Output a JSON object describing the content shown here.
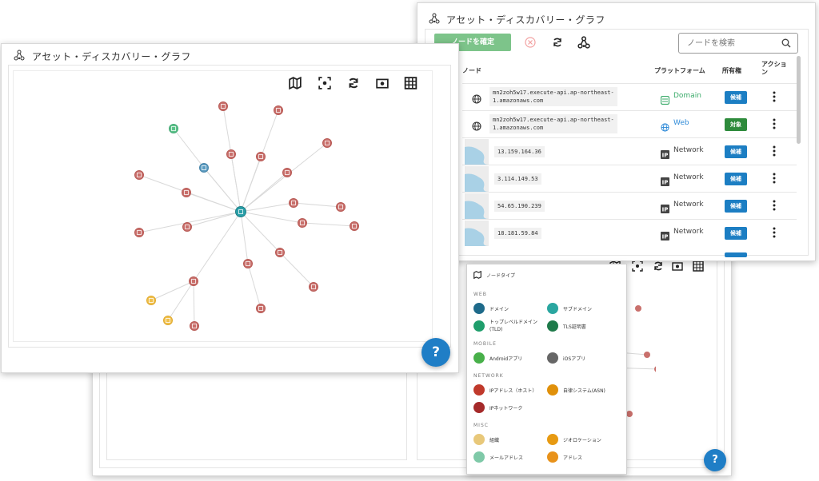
{
  "back_card": {
    "title": "アセット・ディスカバリー・グラフ",
    "confirm_button": "ノードを確定",
    "search_placeholder": "ノードを検索",
    "columns": [
      "ノード",
      "プラットフォーム",
      "所有権",
      "アクション"
    ],
    "rows": [
      {
        "node": "mn2zoh5w17.execute-api.ap-northeast-\n1.amazonaws.com",
        "node_icon": "globe-icon",
        "platform": "Domain",
        "platform_icon": "domain-icon",
        "platform_color": "#3bab6a",
        "ownership": "候補",
        "ownership_color": "#1c7ec3",
        "thumb": false
      },
      {
        "node": "mn2zoh5w17.execute-api.ap-northeast-\n1.amazonaws.com",
        "node_icon": "globe-icon",
        "platform": "Web",
        "platform_icon": "web-icon",
        "platform_color": "#2e8ad8",
        "ownership": "対象",
        "ownership_color": "#2e8b3c",
        "thumb": false
      },
      {
        "node": "13.159.164.36",
        "platform": "Network",
        "platform_icon": "ip-icon",
        "platform_color": "#333333",
        "ownership": "候補",
        "ownership_color": "#1c7ec3",
        "thumb": true
      },
      {
        "node": "3.114.149.53",
        "platform": "Network",
        "platform_icon": "ip-icon",
        "platform_color": "#333333",
        "ownership": "候補",
        "ownership_color": "#1c7ec3",
        "thumb": true
      },
      {
        "node": "54.65.190.239",
        "platform": "Network",
        "platform_icon": "ip-icon",
        "platform_color": "#333333",
        "ownership": "候補",
        "ownership_color": "#1c7ec3",
        "thumb": true
      },
      {
        "node": "18.181.59.84",
        "platform": "Network",
        "platform_icon": "ip-icon",
        "platform_color": "#333333",
        "ownership": "候補",
        "ownership_color": "#1c7ec3",
        "thumb": true
      }
    ]
  },
  "front_card": {
    "title": "アセット・ディスカバリー・グラフ",
    "toolbar": [
      "map-icon",
      "focus-icon",
      "refresh-icon",
      "screenshot-icon",
      "table-icon"
    ],
    "help": "?"
  },
  "legend": {
    "title": "ノードタイプ",
    "sections": [
      {
        "name": "WEB",
        "items": [
          {
            "label": "ドメイン",
            "color": "#1e6a8a"
          },
          {
            "label": "サブドメイン",
            "color": "#2aa6a0"
          },
          {
            "label": "トップレベルドメイン\n(TLD)",
            "color": "#1f9e6c"
          },
          {
            "label": "TLS証明書",
            "color": "#1e7a4a"
          }
        ]
      },
      {
        "name": "MOBILE",
        "items": [
          {
            "label": "Androidアプリ",
            "color": "#48b04a"
          },
          {
            "label": "iOSアプリ",
            "color": "#666666"
          }
        ]
      },
      {
        "name": "NETWORK",
        "items": [
          {
            "label": "IPアドレス（ホスト）",
            "color": "#c0392b"
          },
          {
            "label": "自律システム(ASN)",
            "color": "#e0900a"
          },
          {
            "label": "IPネットワーク",
            "color": "#a52a2a"
          }
        ]
      },
      {
        "name": "MISC",
        "items": [
          {
            "label": "組織",
            "color": "#e8c87a"
          },
          {
            "label": "ジオロケーション",
            "color": "#e79a12"
          },
          {
            "label": "メールアドレス",
            "color": "#7fc9a8"
          },
          {
            "label": "アドレス",
            "color": "#e8921a"
          }
        ]
      }
    ]
  },
  "back_help": "?",
  "colors": {
    "node_red": "#c9706c",
    "node_red_stroke": "#b85b56",
    "hub": "#2a9fa8",
    "green": "#5cc38a",
    "blue": "#5b9bc0",
    "yellow": "#f0c04c"
  }
}
